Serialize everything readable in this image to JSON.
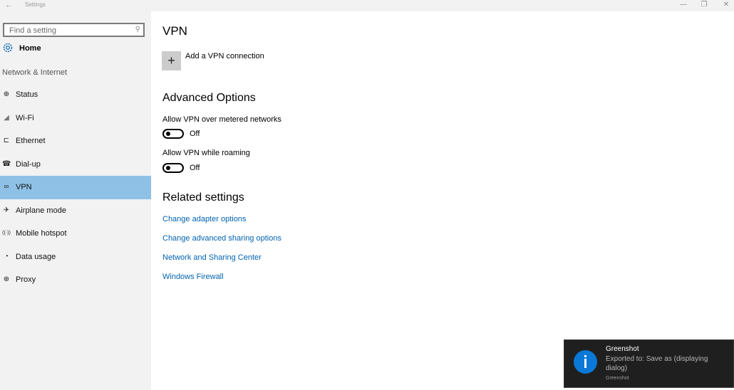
{
  "window": {
    "title": "Settings",
    "back_icon": "←",
    "minimize_icon": "—",
    "maximize_icon": "❐",
    "close_icon": "✕"
  },
  "sidebar": {
    "search_placeholder": "Find a setting",
    "search_icon": "⚲",
    "home_label": "Home",
    "section_label": "Network & Internet",
    "items": [
      {
        "label": "Status",
        "icon": "globe-monitor-icon",
        "glyph": "⊕"
      },
      {
        "label": "Wi-Fi",
        "icon": "wifi-icon",
        "glyph": "◢"
      },
      {
        "label": "Ethernet",
        "icon": "ethernet-icon",
        "glyph": "⊏"
      },
      {
        "label": "Dial-up",
        "icon": "dialup-icon",
        "glyph": "☎"
      },
      {
        "label": "VPN",
        "icon": "vpn-icon",
        "glyph": "∞",
        "selected": true
      },
      {
        "label": "Airplane mode",
        "icon": "airplane-icon",
        "glyph": "✈"
      },
      {
        "label": "Mobile hotspot",
        "icon": "hotspot-icon",
        "glyph": "((·))"
      },
      {
        "label": "Data usage",
        "icon": "data-usage-icon",
        "glyph": "◔"
      },
      {
        "label": "Proxy",
        "icon": "proxy-globe-icon",
        "glyph": "⊕"
      }
    ],
    "selected_color": "#8fc1e7"
  },
  "main": {
    "title": "VPN",
    "add_vpn_label": "Add a VPN connection",
    "add_icon": "+",
    "advanced": {
      "heading": "Advanced Options",
      "options": [
        {
          "label": "Allow VPN over metered networks",
          "state": "Off",
          "on": false
        },
        {
          "label": "Allow VPN while roaming",
          "state": "Off",
          "on": false
        }
      ]
    },
    "related": {
      "heading": "Related settings",
      "links": [
        "Change adapter options",
        "Change advanced sharing options",
        "Network and Sharing Center",
        "Windows Firewall"
      ],
      "link_color": "#0063b1"
    }
  },
  "toast": {
    "title": "Greenshot",
    "body": "Exported to: Save as (displaying dialog)",
    "app": "Greenshot",
    "icon_color": "#0a78d7"
  }
}
